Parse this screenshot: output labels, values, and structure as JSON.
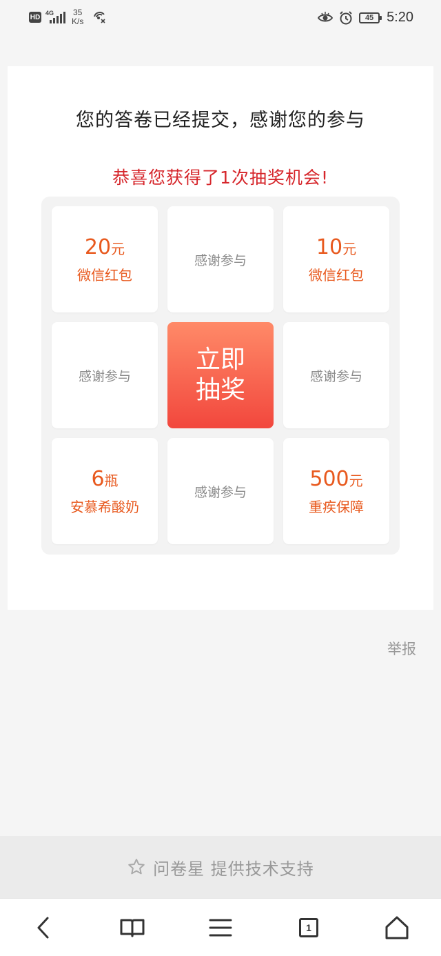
{
  "status_bar": {
    "hd": "HD",
    "network": "4G",
    "speed_value": "35",
    "speed_unit": "K/s",
    "battery": "45",
    "time": "5:20"
  },
  "survey": {
    "thanks_message": "您的答卷已经提交，感谢您的参与",
    "congrats_message": "恭喜您获得了1次抽奖机会!",
    "draw_button_line1": "立即",
    "draw_button_line2": "抽奖",
    "prizes": [
      {
        "amount": "20",
        "unit": "元",
        "name": "微信红包"
      },
      {
        "text": "感谢参与"
      },
      {
        "amount": "10",
        "unit": "元",
        "name": "微信红包"
      },
      {
        "text": "感谢参与"
      },
      {
        "text": "感谢参与"
      },
      {
        "amount": "6",
        "unit": "瓶",
        "name": "安慕希酸奶"
      },
      {
        "text": "感谢参与"
      },
      {
        "amount": "500",
        "unit": "元",
        "name": "重疾保障"
      }
    ]
  },
  "report_label": "举报",
  "support_text": "问卷星 提供技术支持",
  "colors": {
    "accent_red": "#d6262b",
    "prize_orange": "#e8591e",
    "button_top": "#ff8a68",
    "button_bottom": "#f2473d"
  },
  "nav_icons": [
    "back-icon",
    "bookmarks-icon",
    "menu-icon",
    "tabs-icon",
    "home-icon"
  ],
  "tabs_count": "1"
}
